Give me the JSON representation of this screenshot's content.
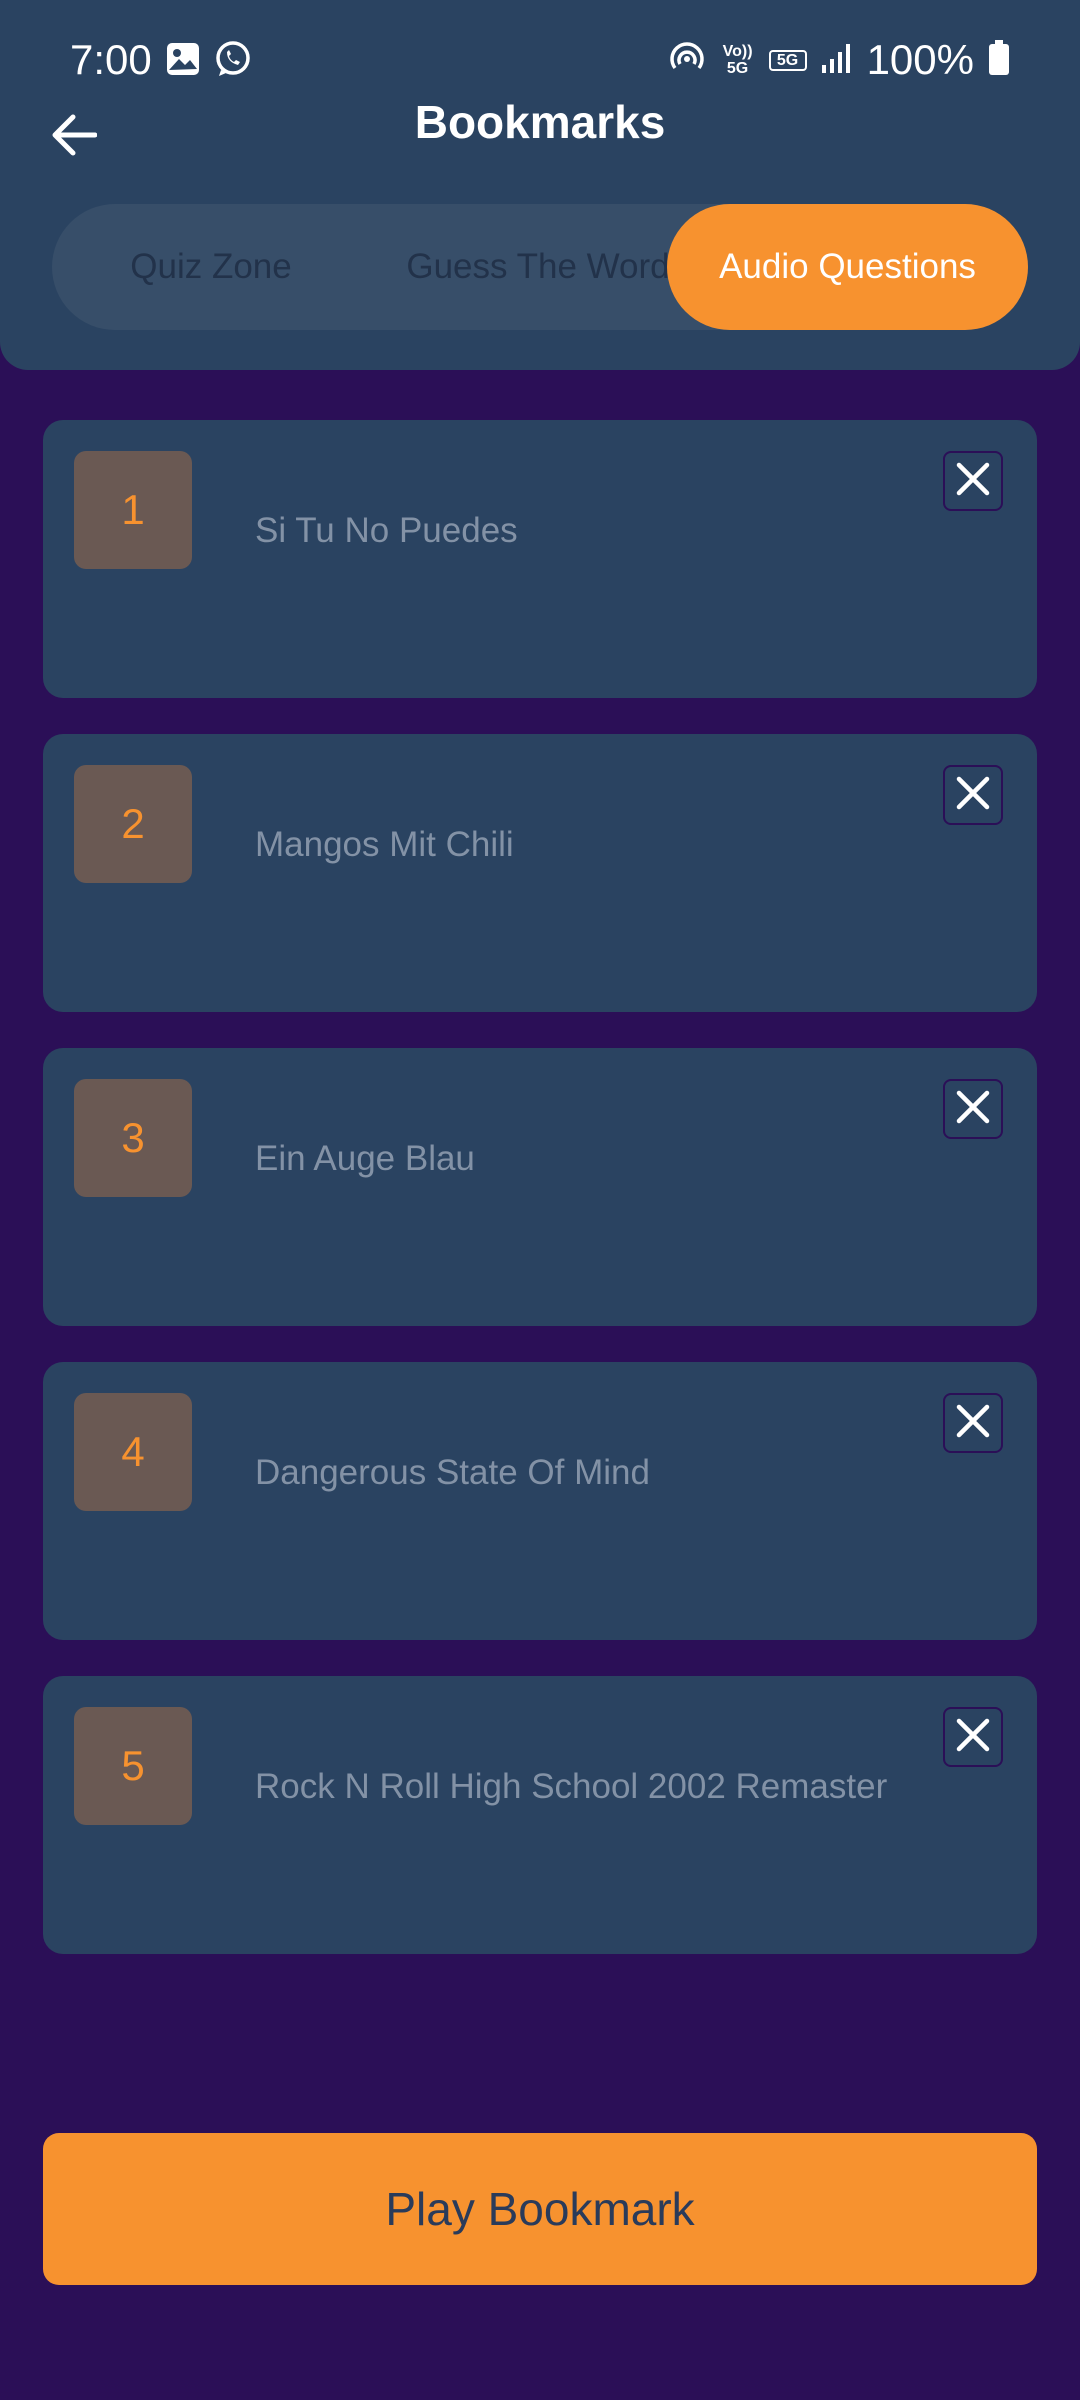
{
  "status_bar": {
    "time": "7:00",
    "battery": "100%",
    "volte_label": "Vo)) 5G",
    "network_label": "5G"
  },
  "header": {
    "title": "Bookmarks"
  },
  "tabs": [
    {
      "label": "Quiz Zone",
      "selected": false
    },
    {
      "label": "Guess The Word",
      "selected": false
    },
    {
      "label": "Audio Questions",
      "selected": true
    }
  ],
  "bookmarks": [
    {
      "number": "1",
      "title": "Si Tu No Puedes"
    },
    {
      "number": "2",
      "title": "Mangos Mit Chili"
    },
    {
      "number": "3",
      "title": "Ein Auge Blau"
    },
    {
      "number": "4",
      "title": "Dangerous State Of Mind"
    },
    {
      "number": "5",
      "title": "Rock N Roll High School 2002 Remaster"
    }
  ],
  "play_button": {
    "label": "Play Bookmark"
  },
  "colors": {
    "background": "#2b0f57",
    "panel": "#2a4361",
    "accent": "#f7922f",
    "number_box": "#6a5953",
    "muted_text": "#8392a6"
  },
  "icons": [
    "image-icon",
    "whatsapp-icon",
    "hotspot-icon",
    "signal-icon",
    "battery-icon",
    "back-arrow-icon",
    "close-icon"
  ]
}
